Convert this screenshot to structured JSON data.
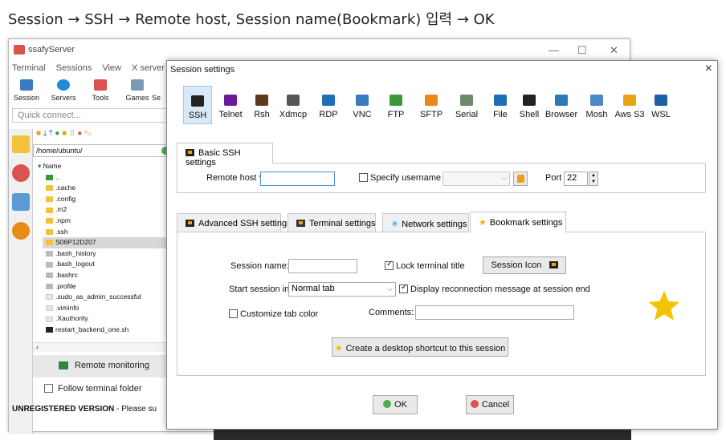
{
  "caption": "Session → SSH → Remote host, Session name(Bookmark) 입력 → OK",
  "background_window": {
    "title": "ssafyServer",
    "menu": [
      "Terminal",
      "Sessions",
      "View",
      "X server",
      "T"
    ],
    "toolbar": [
      "Session",
      "Servers",
      "Tools",
      "Games",
      "Se"
    ],
    "quick_connect": "Quick connect...",
    "path": "/home/ubuntu/",
    "files": [
      {
        "name": "Name",
        "kind": "header"
      },
      {
        "name": "..",
        "kind": "up"
      },
      {
        "name": ".cache",
        "kind": "folder"
      },
      {
        "name": ".config",
        "kind": "folder"
      },
      {
        "name": ".m2",
        "kind": "folder"
      },
      {
        "name": ".npm",
        "kind": "folder"
      },
      {
        "name": ".ssh",
        "kind": "folder"
      },
      {
        "name": "S06P12D207",
        "kind": "folder",
        "selected": true
      },
      {
        "name": ".bash_history",
        "kind": "file"
      },
      {
        "name": ".bash_logout",
        "kind": "file"
      },
      {
        "name": ".bashrc",
        "kind": "file"
      },
      {
        "name": ".profile",
        "kind": "file"
      },
      {
        "name": ".sudo_as_admin_successful",
        "kind": "blank"
      },
      {
        "name": ".viminfo",
        "kind": "blank"
      },
      {
        "name": ".Xauthority",
        "kind": "blank"
      },
      {
        "name": "restart_backend_one.sh",
        "kind": "script"
      }
    ],
    "remote_monitoring": "Remote monitoring",
    "follow_terminal": "Follow terminal folder",
    "unregistered": "UNREGISTERED VERSION",
    "unregistered_suffix": " -  Please su"
  },
  "dialog": {
    "title": "Session settings",
    "close": "×",
    "session_types": [
      {
        "label": "SSH",
        "icon": "ssh-icon",
        "color": "#222222",
        "active": true
      },
      {
        "label": "Telnet",
        "icon": "telnet-icon",
        "color": "#6a1b9a"
      },
      {
        "label": "Rsh",
        "icon": "rsh-icon",
        "color": "#5d3a1a"
      },
      {
        "label": "Xdmcp",
        "icon": "xdmcp-icon",
        "color": "#555555"
      },
      {
        "label": "RDP",
        "icon": "rdp-icon",
        "color": "#1e6fb8"
      },
      {
        "label": "VNC",
        "icon": "vnc-icon",
        "color": "#3a7bbf"
      },
      {
        "label": "FTP",
        "icon": "ftp-icon",
        "color": "#3a9a3a"
      },
      {
        "label": "SFTP",
        "icon": "sftp-icon",
        "color": "#e88a17"
      },
      {
        "label": "Serial",
        "icon": "serial-icon",
        "color": "#6a8a6a"
      },
      {
        "label": "File",
        "icon": "file-icon",
        "color": "#1e6fb8"
      },
      {
        "label": "Shell",
        "icon": "shell-icon",
        "color": "#222222"
      },
      {
        "label": "Browser",
        "icon": "browser-icon",
        "color": "#2a7ab8"
      },
      {
        "label": "Mosh",
        "icon": "mosh-icon",
        "color": "#4a8ac8"
      },
      {
        "label": "Aws S3",
        "icon": "aws-s3-icon",
        "color": "#e8a317"
      },
      {
        "label": "WSL",
        "icon": "wsl-icon",
        "color": "#1e5fa8"
      }
    ],
    "basic_tab": "Basic SSH settings",
    "remote_host_label": "Remote host *",
    "remote_host_value": "",
    "specify_username": "Specify username",
    "port_label": "Port",
    "port_value": "22",
    "subtabs": [
      "Advanced SSH settings",
      "Terminal settings",
      "Network settings",
      "Bookmark settings"
    ],
    "session_name_label": "Session name:",
    "session_name_value": "",
    "lock_terminal": "Lock terminal title",
    "session_icon_btn": "Session Icon",
    "start_session_label": "Start session in",
    "start_session_value": "Normal tab",
    "display_reconnect": "Display reconnection message at session end",
    "customize_tab": "Customize tab color",
    "comments_label": "Comments:",
    "comments_value": "",
    "desktop_shortcut": "Create a desktop shortcut to this session",
    "ok": "OK",
    "cancel": "Cancel"
  }
}
